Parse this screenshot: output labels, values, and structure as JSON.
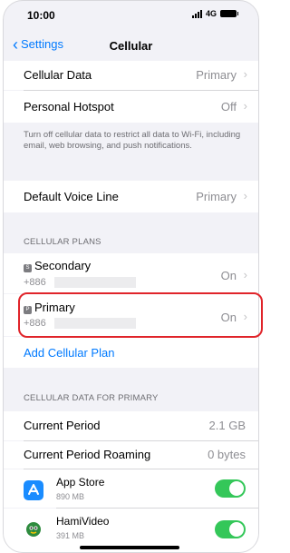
{
  "status_bar": {
    "time": "10:00",
    "network": "4G"
  },
  "nav": {
    "back_label": "Settings",
    "title": "Cellular"
  },
  "rows": {
    "cellular_data": {
      "label": "Cellular Data",
      "value": "Primary"
    },
    "personal_hotspot": {
      "label": "Personal Hotspot",
      "value": "Off"
    },
    "footnote": "Turn off cellular data to restrict all data to Wi-Fi, including email, web browsing, and push notifications.",
    "default_voice_line": {
      "label": "Default Voice Line",
      "value": "Primary"
    }
  },
  "plans": {
    "header": "CELLULAR PLANS",
    "items": [
      {
        "badge": "S",
        "name": "Secondary",
        "number": "+886",
        "status": "On"
      },
      {
        "badge": "P",
        "name": "Primary",
        "number": "+886",
        "status": "On"
      }
    ],
    "add_label": "Add Cellular Plan"
  },
  "usage": {
    "header": "CELLULAR DATA FOR PRIMARY",
    "current_period": {
      "label": "Current Period",
      "value": "2.1 GB"
    },
    "roaming": {
      "label": "Current Period Roaming",
      "value": "0 bytes"
    },
    "apps": [
      {
        "name": "App Store",
        "size": "890 MB",
        "icon": "app-store-icon",
        "enabled": true
      },
      {
        "name": "HamiVideo",
        "size": "391 MB",
        "icon": "hamivideo-icon",
        "enabled": true
      }
    ]
  },
  "colors": {
    "accent": "#007aff",
    "toggle_on": "#34c759",
    "highlight": "#e0242a"
  }
}
